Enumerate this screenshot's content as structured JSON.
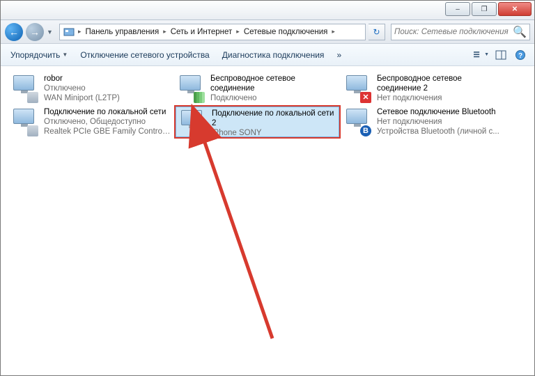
{
  "window": {
    "min": "–",
    "max": "❐",
    "close": "✕"
  },
  "breadcrumbs": [
    "Панель управления",
    "Сеть и Интернет",
    "Сетевые подключения"
  ],
  "search": {
    "placeholder": "Поиск: Сетевые подключения"
  },
  "toolbar": {
    "organize": "Упорядочить",
    "disable": "Отключение сетевого устройства",
    "diagnose": "Диагностика подключения",
    "more": "»"
  },
  "connections": [
    {
      "name": "robor",
      "status": "Отключено",
      "device": "WAN Miniport (L2TP)",
      "badge": "cable"
    },
    {
      "name": "Беспроводное сетевое соединение",
      "status": "Подключено",
      "device": "",
      "badge": "bars"
    },
    {
      "name": "Беспроводное сетевое соединение 2",
      "status": "Нет подключения",
      "device": "",
      "badge": "red-x"
    },
    {
      "name": "Подключение по локальной сети",
      "status": "Отключено, Общедоступно",
      "device": "Realtek PCIe GBE Family Controller",
      "badge": "cable"
    },
    {
      "name": "Подключение по локальной сети 2",
      "status": "",
      "device": "iPhone SONY",
      "badge": "cable",
      "selected": true
    },
    {
      "name": "Сетевое подключение Bluetooth",
      "status": "Нет подключения",
      "device": "Устройства Bluetooth (личной с...",
      "badge": "bt"
    }
  ]
}
